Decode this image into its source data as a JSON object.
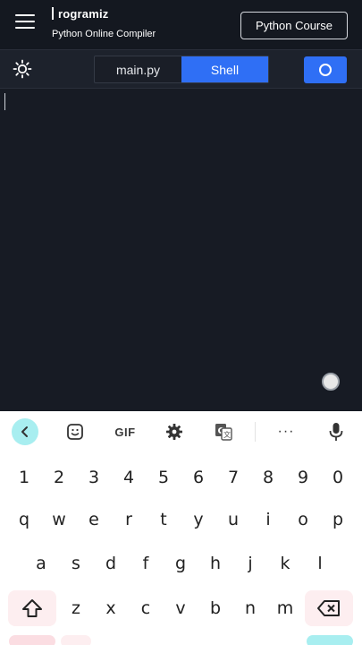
{
  "header": {
    "logo_text": "rogramiz",
    "subtitle": "Python Online Compiler",
    "course_button": "Python Course"
  },
  "toolbar": {
    "tabs": [
      {
        "label": "main.py",
        "active": false
      },
      {
        "label": "Shell",
        "active": true
      }
    ],
    "accent_color": "#2f6ff5"
  },
  "keyboard": {
    "toolbar": {
      "icons": [
        "back-chevron-icon",
        "sticker-icon",
        "gif-label",
        "gear-icon",
        "translate-icon",
        "more-icon",
        "mic-icon"
      ],
      "gif_label": "GIF",
      "more_label": "···"
    },
    "number_row": [
      "1",
      "2",
      "3",
      "4",
      "5",
      "6",
      "7",
      "8",
      "9",
      "0"
    ],
    "row1": [
      "q",
      "w",
      "e",
      "r",
      "t",
      "y",
      "u",
      "i",
      "o",
      "p"
    ],
    "row2": [
      "a",
      "s",
      "d",
      "f",
      "g",
      "h",
      "j",
      "k",
      "l"
    ],
    "row3": [
      "z",
      "x",
      "c",
      "v",
      "b",
      "n",
      "m"
    ]
  }
}
